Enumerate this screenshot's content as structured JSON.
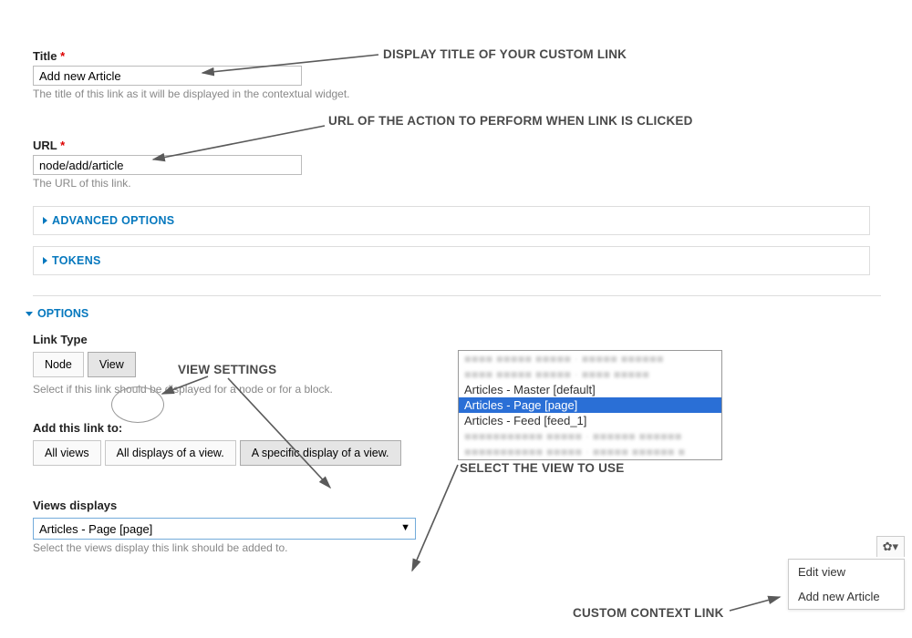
{
  "title_field": {
    "label": "Title",
    "required": true,
    "value": "Add new Article",
    "help": "The title of this link as it will be displayed in the contextual widget."
  },
  "url_field": {
    "label": "URL",
    "required": true,
    "value": "node/add/article",
    "help": "The URL of this link."
  },
  "fieldsets": {
    "advanced": "ADVANCED OPTIONS",
    "tokens": "TOKENS",
    "options": "OPTIONS"
  },
  "link_type": {
    "label": "Link Type",
    "options": [
      "Node",
      "View"
    ],
    "selected": "View",
    "help": "Select if this link should be displayed for a node or for a block."
  },
  "add_to": {
    "label": "Add this link to:",
    "options": [
      "All views",
      "All displays of a view.",
      "A specific display of a view."
    ],
    "selected": "A specific display of a view."
  },
  "views_displays": {
    "label": "Views displays",
    "selected": "Articles - Page [page]",
    "help": "Select the views display this link should be added to."
  },
  "listbox_items": [
    "Articles - Master [default]",
    "Articles - Page [page]",
    "Articles - Feed [feed_1]"
  ],
  "listbox_selected_index": 1,
  "context_menu": {
    "edit": "Edit view",
    "custom": "Add new Article"
  },
  "annotations": {
    "a_title": "DISPLAY TITLE OF YOUR CUSTOM LINK",
    "a_url": "URL OF THE ACTION TO PERFORM WHEN LINK IS CLICKED",
    "a_view": "VIEW SETTINGS",
    "a_select": "SELECT THE VIEW TO USE",
    "a_ctx": "CUSTOM CONTEXT LINK"
  }
}
